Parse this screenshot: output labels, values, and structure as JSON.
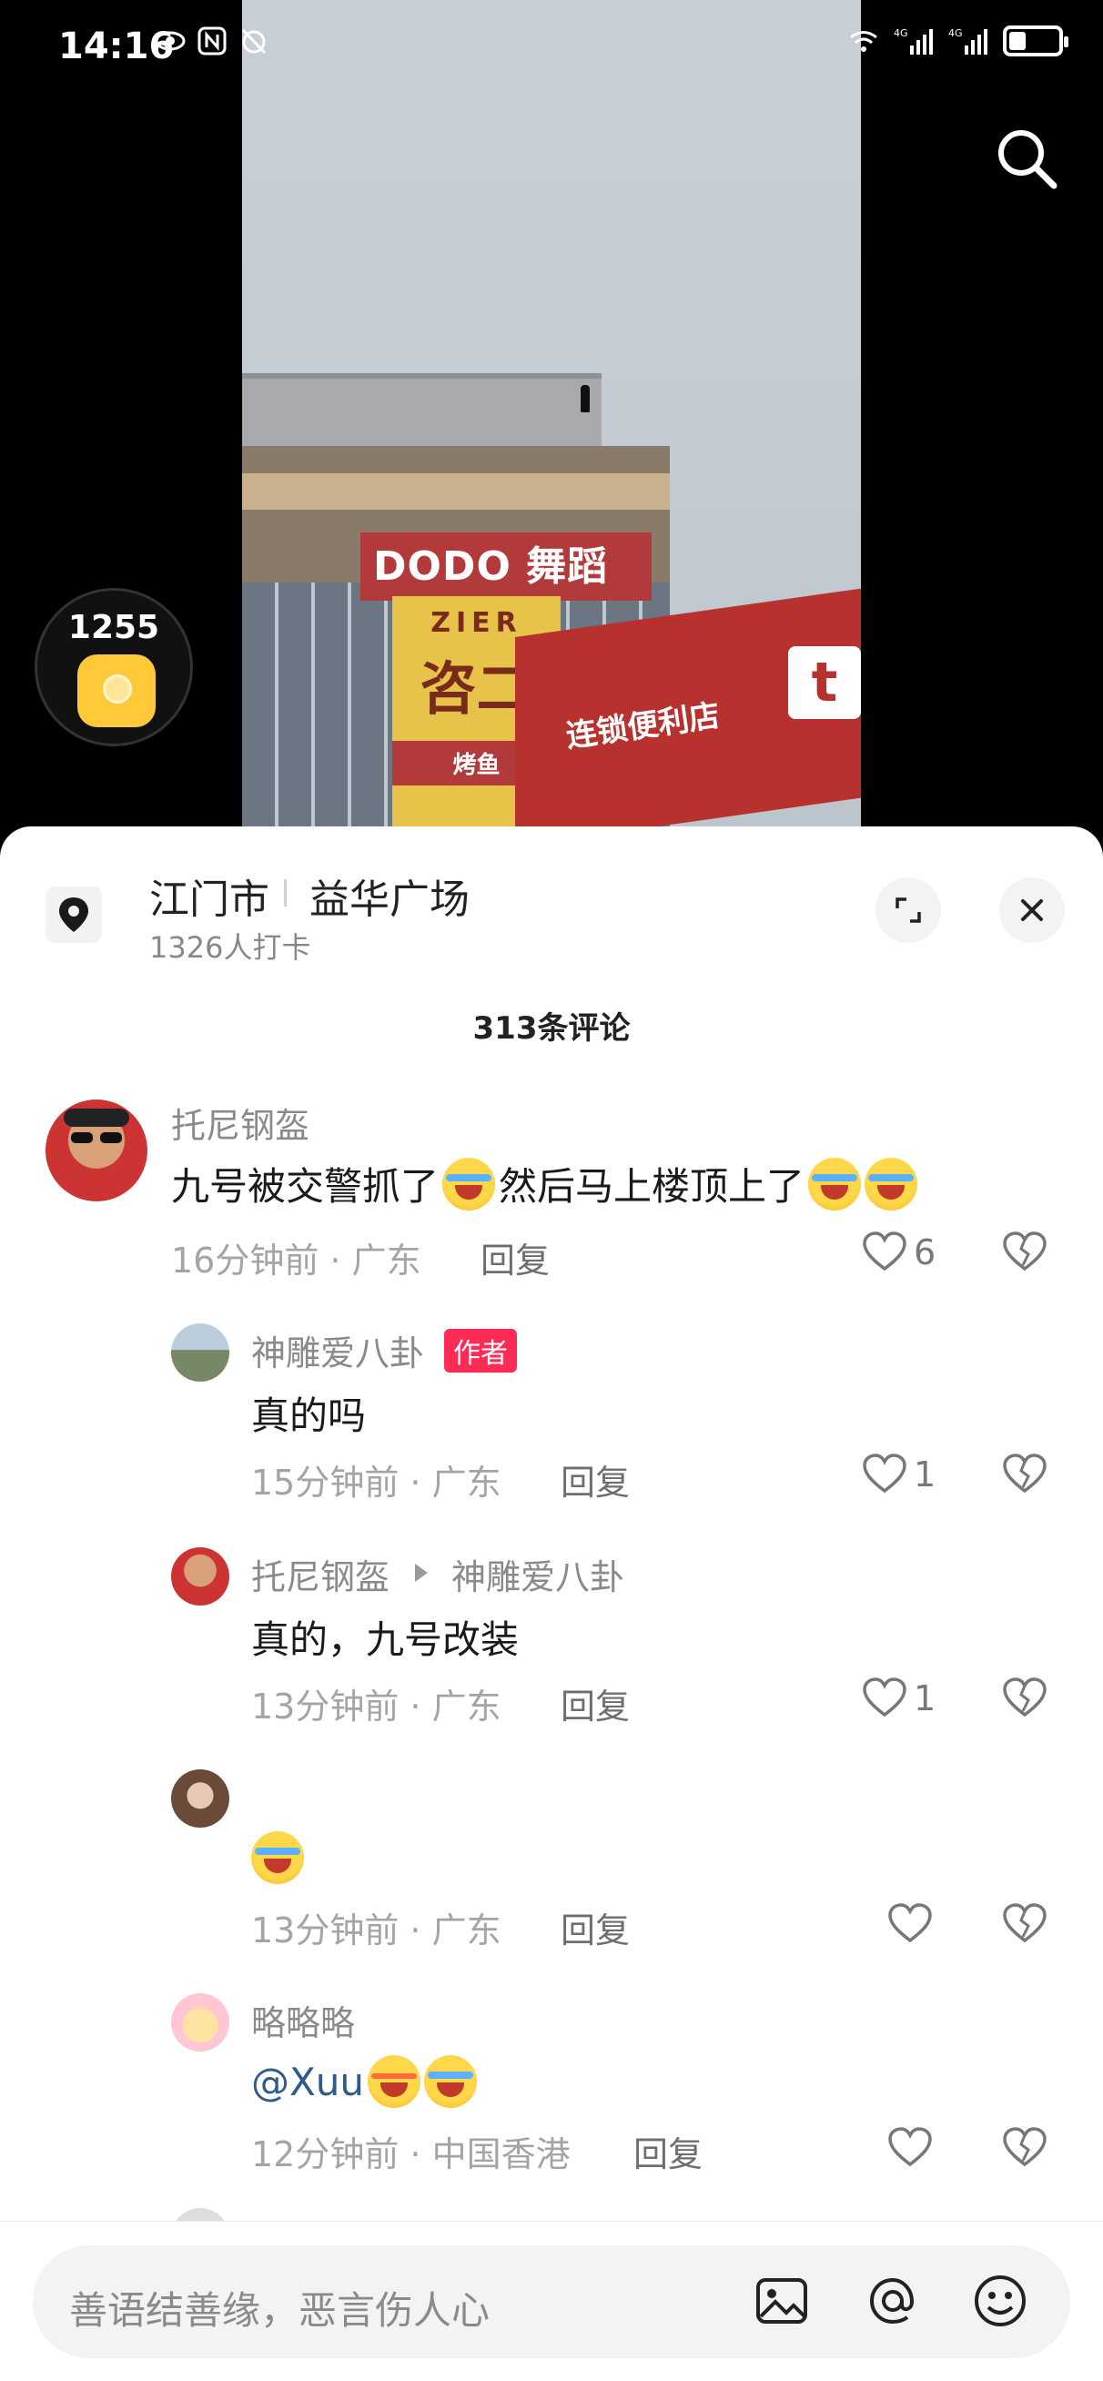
{
  "status_bar": {
    "time": "14:16"
  },
  "coin_widget": {
    "count": "1255"
  },
  "location": {
    "city": "江门市",
    "place": "益华广场",
    "checkins": "1326人打卡"
  },
  "comments_header": {
    "count_label": "313条评论"
  },
  "comments": [
    {
      "user": "托尼钢盔",
      "text_a": "九号被交警抓了",
      "text_b": "然后马上楼顶上了",
      "time": "16分钟前 · 广东",
      "reply": "回复",
      "likes": "6"
    },
    {
      "user": "神雕爱八卦",
      "badge": "作者",
      "text": "真的吗",
      "time": "15分钟前 · 广东",
      "reply": "回复",
      "likes": "1"
    },
    {
      "user": "托尼钢盔",
      "reply_to": "神雕爱八卦",
      "text": "真的，九号改装",
      "time": "13分钟前 · 广东",
      "reply": "回复",
      "likes": "1"
    },
    {
      "user": "",
      "time": "13分钟前 · 广东",
      "reply": "回复"
    },
    {
      "user": "略略略",
      "text": "@Xuu",
      "time": "12分钟前 · 中国香港",
      "reply": "回复"
    }
  ],
  "input": {
    "placeholder": "善语结善缘，恶言伤人心"
  },
  "video": {
    "sign_dodo": "DODO 舞蹈",
    "sign_zier_top": "ZIER",
    "sign_zier_main": "咨二",
    "sign_zier_sub": "烤鱼",
    "store_text": "连锁便利店"
  },
  "colors": {
    "accent": "#fe2c55",
    "mention": "#2f5a8c"
  }
}
